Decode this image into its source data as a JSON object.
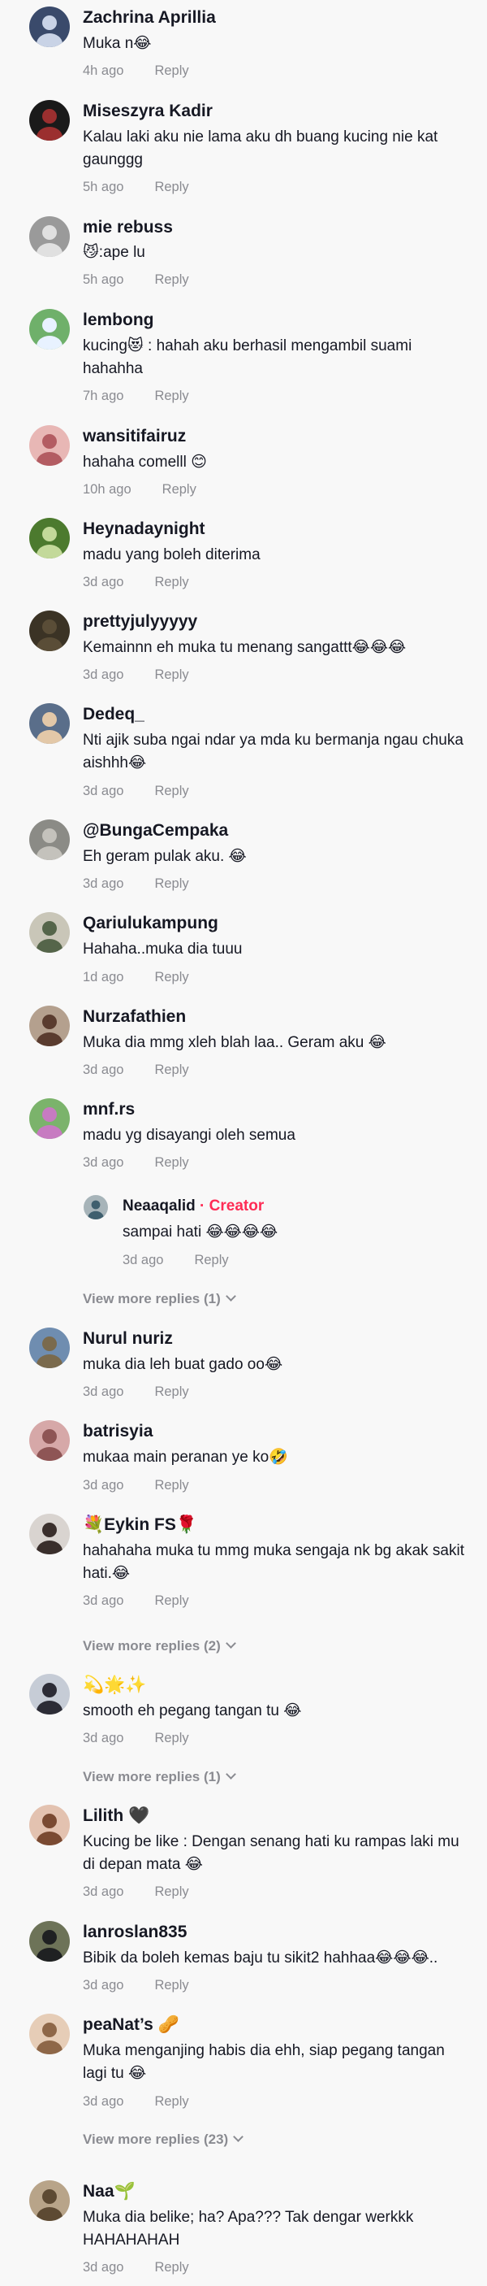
{
  "comments": [
    {
      "user": "Zachrina Aprillia",
      "text": "Muka n😂",
      "time": "4h ago",
      "reply": "Reply",
      "avatar": {
        "bg": "#3a4a6b",
        "fg": "#c9d3e6"
      }
    },
    {
      "user": "Miseszyra Kadir",
      "text": "Kalau laki aku nie lama aku dh buang kucing nie kat gaunggg",
      "time": "5h ago",
      "reply": "Reply",
      "avatar": {
        "bg": "#1a1a1a",
        "fg": "#9b2f2f"
      }
    },
    {
      "user": "mie rebuss",
      "text": "😼:ape lu",
      "time": "5h ago",
      "reply": "Reply",
      "avatar": {
        "bg": "#9a9a9a",
        "fg": "#e0e0e0"
      }
    },
    {
      "user": "lembong",
      "text": "kucing😻 : hahah aku berhasil mengambil suami hahahha",
      "time": "7h ago",
      "reply": "Reply",
      "avatar": {
        "bg": "#6fb06a",
        "fg": "#e8f2ff"
      }
    },
    {
      "user": "wansitifairuz",
      "text": "hahaha comelll 😊",
      "time": "10h ago",
      "reply": "Reply",
      "avatar": {
        "bg": "#e8b7b5",
        "fg": "#b35c62"
      }
    },
    {
      "user": "Heynadaynight",
      "text": "madu yang boleh diterima",
      "time": "3d ago",
      "reply": "Reply",
      "avatar": {
        "bg": "#4c7a2e",
        "fg": "#c3d99a"
      }
    },
    {
      "user": "prettyjulyyyyy",
      "text": "Kemainnn eh muka tu menang sangattt😂😂😂",
      "time": "3d ago",
      "reply": "Reply",
      "avatar": {
        "bg": "#3b3325",
        "fg": "#5a4d37"
      }
    },
    {
      "user": "Dedeq_",
      "text": "Nti ajik suba ngai ndar ya mda ku bermanja ngau chuka aishhh😂",
      "time": "3d ago",
      "reply": "Reply",
      "avatar": {
        "bg": "#5a6e8a",
        "fg": "#e3c8a8"
      }
    },
    {
      "user": "@BungaCempaka",
      "text": "Eh geram pulak aku. 😂",
      "time": "3d ago",
      "reply": "Reply",
      "avatar": {
        "bg": "#8b8b86",
        "fg": "#c4c2bc"
      }
    },
    {
      "user": "Qariulukampung",
      "text": "Hahaha..muka dia tuuu",
      "time": "1d ago",
      "reply": "Reply",
      "avatar": {
        "bg": "#c9c6b8",
        "fg": "#55654a"
      }
    },
    {
      "user": "Nurzafathien",
      "text": "Muka dia mmg xleh blah laa.. Geram aku 😂",
      "time": "3d ago",
      "reply": "Reply",
      "avatar": {
        "bg": "#b4a08e",
        "fg": "#5a3c2f"
      }
    },
    {
      "user": "mnf.rs",
      "text": "madu yg disayangi oleh semua",
      "time": "3d ago",
      "reply": "Reply",
      "avatar": {
        "bg": "#7bb36b",
        "fg": "#c77bc1"
      }
    },
    {
      "user": "Nurul nuriz",
      "text": "muka dia leh buat gado oo😂",
      "time": "3d ago",
      "reply": "Reply",
      "avatar": {
        "bg": "#6f8db0",
        "fg": "#7a6a4d"
      }
    },
    {
      "user": "batrisyia",
      "text": "mukaa main peranan ye ko🤣",
      "time": "3d ago",
      "reply": "Reply",
      "avatar": {
        "bg": "#d6a8a8",
        "fg": "#8e5555"
      }
    },
    {
      "user": "💐Eykin FS🌹",
      "text": "hahahaha muka tu mmg muka sengaja nk bg akak sakit hati.😂",
      "time": "3d ago",
      "reply": "Reply",
      "avatar": {
        "bg": "#d9d4d0",
        "fg": "#3a2f2c"
      }
    },
    {
      "user": "💫🌟✨",
      "text": "smooth eh pegang tangan tu 😂",
      "time": "3d ago",
      "reply": "Reply",
      "avatar": {
        "bg": "#c6ccd6",
        "fg": "#2c2c36"
      }
    },
    {
      "user": "Lilith 🖤",
      "text": "Kucing be like : Dengan senang hati ku rampas laki mu di depan mata 😂",
      "time": "3d ago",
      "reply": "Reply",
      "avatar": {
        "bg": "#e3c2b0",
        "fg": "#7a4a32"
      }
    },
    {
      "user": "lanroslan835",
      "text": "Bibik da boleh kemas baju tu sikit2 hahhaa😂😂😂..",
      "time": "3d ago",
      "reply": "Reply",
      "avatar": {
        "bg": "#6d7358",
        "fg": "#1f2122"
      }
    },
    {
      "user": "peaNat’s 🥜",
      "text": "Muka menganjing habis dia ehh, siap pegang tangan lagi tu 😂",
      "time": "3d ago",
      "reply": "Reply",
      "avatar": {
        "bg": "#e6cdb7",
        "fg": "#8e6748"
      }
    },
    {
      "user": "Naa🌱",
      "text": "Muka dia belike; ha? Apa??? Tak dengar werkkk HAHAHAHAH",
      "time": "3d ago",
      "reply": "Reply",
      "avatar": {
        "bg": "#b8a489",
        "fg": "#5d4a33"
      }
    }
  ],
  "nested_reply": {
    "user": "Neaaqalid",
    "badge": "Creator",
    "separator": "·",
    "text": "sampai hati 😂😂😂😂",
    "time": "3d ago",
    "reply": "Reply",
    "avatar": {
      "bg": "#a7b4b9",
      "fg": "#3f5f6e"
    }
  },
  "view_more": [
    {
      "label": "View more replies (1)"
    },
    {
      "label": "View more replies (2)"
    },
    {
      "label": "View more replies (1)"
    },
    {
      "label": "View more replies (23)"
    }
  ]
}
